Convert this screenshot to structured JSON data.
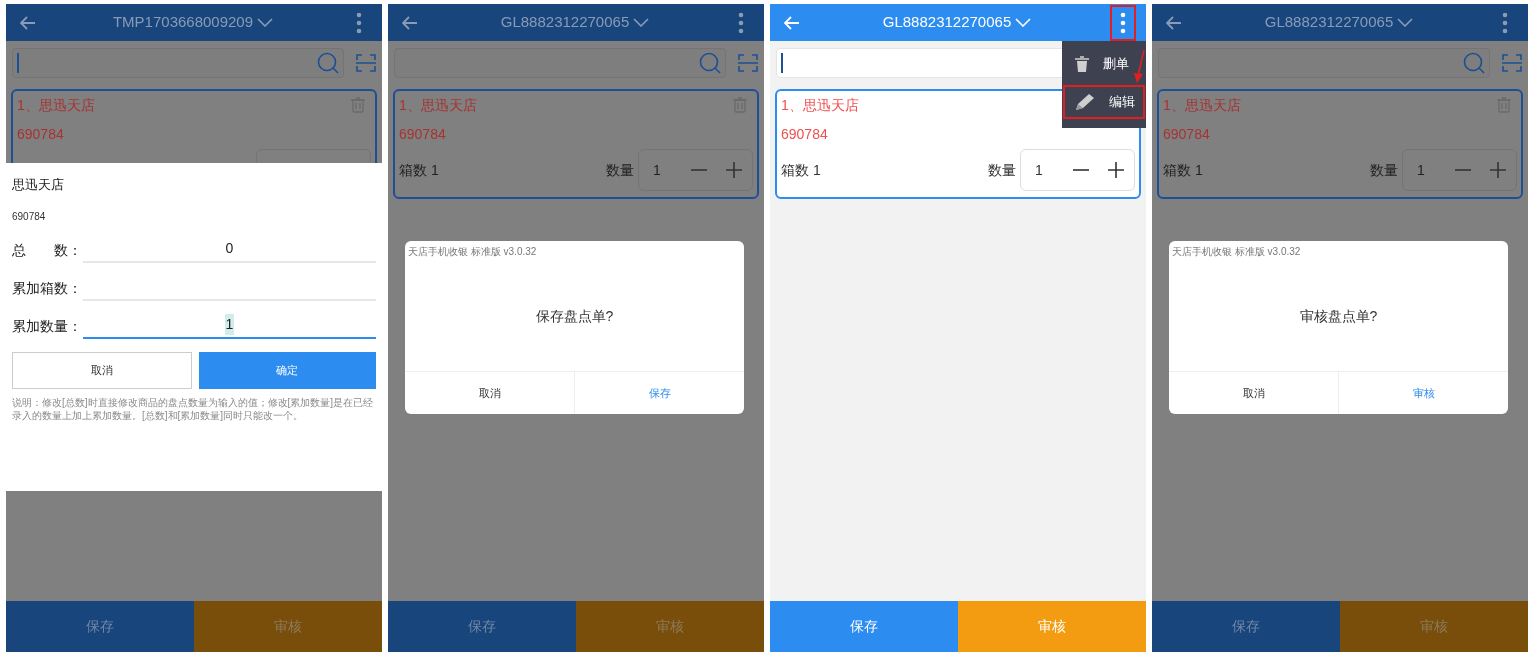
{
  "panels": [
    {
      "dimmed": true,
      "header": {
        "title": "TMP1703668009209",
        "more_highlighted": false
      },
      "search": {
        "focused": true
      },
      "card": {
        "title": "1、思迅天店",
        "code": "690784"
      },
      "overlay": {
        "kind": "sheet",
        "name": "思迅天店",
        "code": "690784",
        "fields": [
          {
            "label": "总　　数：",
            "value": "0",
            "focused": false
          },
          {
            "label": "累加箱数：",
            "focused": false
          },
          {
            "label": "累加数量：",
            "value": "1",
            "focused": true
          }
        ],
        "buttons": [
          {
            "label": "取消",
            "primary": false
          },
          {
            "label": "确定",
            "primary": true
          }
        ],
        "note": "说明：修改[总数]时直接修改商品的盘点数量为输入的值；修改[累加数量]是在已经录入的数量上加上累加数量。[总数]和[累加数量]同时只能改一个。"
      },
      "bottom": [
        {
          "label": "保存"
        },
        {
          "label": "审核"
        }
      ]
    },
    {
      "dimmed": true,
      "header": {
        "title": "GL8882312270065",
        "more_highlighted": false
      },
      "search": {
        "focused": false
      },
      "card": {
        "title": "1、思迅天店",
        "code": "690784",
        "boxes": "箱数 1",
        "qty_label": "数量",
        "qty": "1"
      },
      "overlay": {
        "kind": "dialog",
        "caption": "天店手机收银 标准版 v3.0.32",
        "message": "保存盘点单?",
        "buttons": [
          {
            "label": "取消",
            "primary": false
          },
          {
            "label": "保存",
            "primary": true
          }
        ]
      },
      "bottom": [
        {
          "label": "保存"
        },
        {
          "label": "审核"
        }
      ]
    },
    {
      "dimmed": false,
      "header": {
        "title": "GL8882312270065",
        "more_highlighted": true
      },
      "search": {
        "focused": true
      },
      "card": {
        "title": "1、思迅天店",
        "code": "690784",
        "boxes": "箱数 1",
        "qty_label": "数量",
        "qty": "1"
      },
      "overlay": {
        "kind": "menu",
        "arrow": true,
        "items": [
          {
            "label": "删单",
            "highlighted": false
          },
          {
            "label": "编辑",
            "highlighted": true
          }
        ]
      },
      "bottom": [
        {
          "label": "保存"
        },
        {
          "label": "审核"
        }
      ]
    },
    {
      "dimmed": true,
      "header": {
        "title": "GL8882312270065",
        "more_highlighted": false
      },
      "search": {
        "focused": false
      },
      "card": {
        "title": "1、思迅天店",
        "code": "690784",
        "boxes": "箱数 1",
        "qty_label": "数量",
        "qty": "1"
      },
      "overlay": {
        "kind": "dialog",
        "caption": "天店手机收银 标准版 v3.0.32",
        "message": "审核盘点单?",
        "buttons": [
          {
            "label": "取消",
            "primary": false
          },
          {
            "label": "审核",
            "primary": true
          }
        ]
      },
      "bottom": [
        {
          "label": "保存"
        },
        {
          "label": "审核"
        }
      ]
    }
  ]
}
